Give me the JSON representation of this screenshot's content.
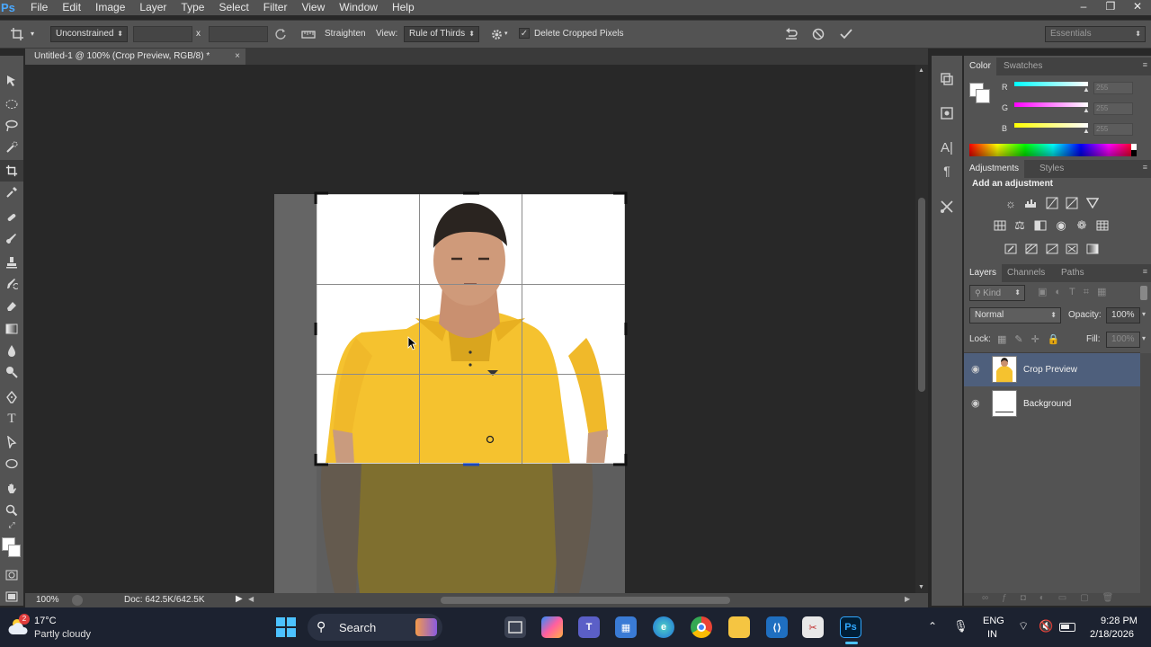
{
  "app": {
    "logo": "Ps"
  },
  "menu": [
    "File",
    "Edit",
    "Image",
    "Layer",
    "Type",
    "Select",
    "Filter",
    "View",
    "Window",
    "Help"
  ],
  "window_controls": {
    "minimize": "–",
    "restore": "❐",
    "close": "✕"
  },
  "options": {
    "ratio_value": "Unconstrained",
    "times_sign": "x",
    "straighten_label": "Straighten",
    "view_label": "View:",
    "view_value": "Rule of Thirds",
    "delete_cropped_label": "Delete Cropped Pixels",
    "delete_cropped_checked": true,
    "workspace": "Essentials"
  },
  "document": {
    "tab_title": "Untitled-1 @ 100% (Crop Preview, RGB/8) *",
    "tab_close": "×"
  },
  "status": {
    "zoom": "100%",
    "doc_info": "Doc: 642.5K/642.5K"
  },
  "color_panel": {
    "tabs": [
      "Color",
      "Swatches"
    ],
    "channels": [
      {
        "label": "R",
        "value": "255",
        "gradient": "#00ffff,#ffffff"
      },
      {
        "label": "G",
        "value": "255",
        "gradient": "#ff00ff,#ffffff"
      },
      {
        "label": "B",
        "value": "255",
        "gradient": "#ffff00,#ffffff"
      }
    ]
  },
  "adjustments_panel": {
    "tabs": [
      "Adjustments",
      "Styles"
    ],
    "heading": "Add an adjustment"
  },
  "layers_panel": {
    "tabs": [
      "Layers",
      "Channels",
      "Paths"
    ],
    "kind": "Kind",
    "blend_mode": "Normal",
    "opacity_label": "Opacity:",
    "opacity_value": "100%",
    "lock_label": "Lock:",
    "fill_label": "Fill:",
    "fill_value": "100%",
    "layers": [
      {
        "name": "Crop Preview",
        "selected": true
      },
      {
        "name": "Background",
        "selected": false
      }
    ]
  },
  "taskbar": {
    "weather_temp": "17°C",
    "weather_desc": "Partly cloudy",
    "weather_badge": "2",
    "search_label": "Search",
    "lang_line1": "ENG",
    "lang_line2": "IN",
    "time": "9:28 PM",
    "date": "2/18/2026"
  },
  "colors": {
    "accent": "#4aa8ff",
    "shirt": "#f5c22f",
    "selected_layer": "#4e5f7c"
  }
}
